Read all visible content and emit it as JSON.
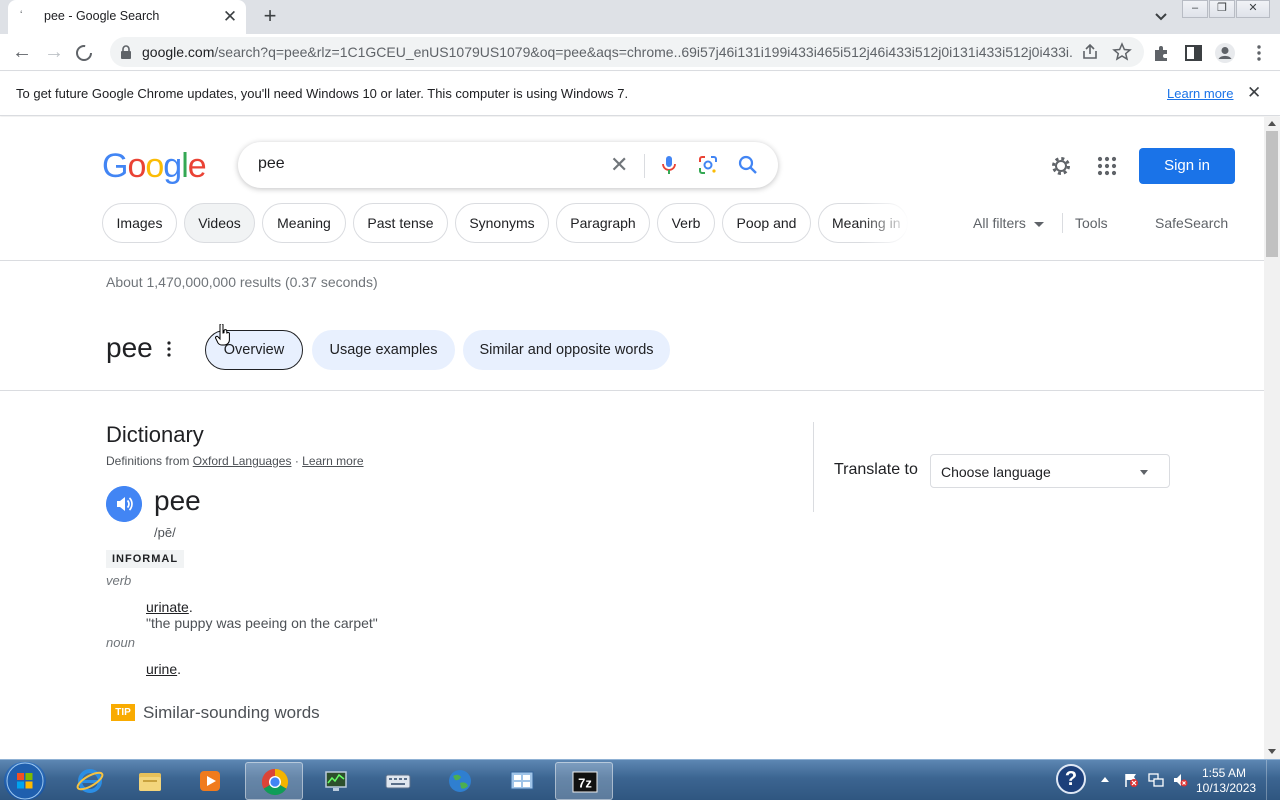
{
  "browser": {
    "tab_title": "pee - Google Search",
    "url_host": "google.com",
    "url_path": "/search?q=pee&rlz=1C1GCEU_enUS1079US1079&oq=pee&aqs=chrome..69i57j46i131i199i433i465i512j46i433i512j0i131i433i512j0i433i..."
  },
  "infobar": {
    "message": "To get future Google Chrome updates, you'll need Windows 10 or later. This computer is using Windows 7.",
    "link": "Learn more"
  },
  "search": {
    "query": "pee",
    "signin_label": "Sign in"
  },
  "chips": [
    "Images",
    "Videos",
    "Meaning",
    "Past tense",
    "Synonyms",
    "Paragraph",
    "Verb",
    "Poop and",
    "Meaning in"
  ],
  "tools": {
    "all_filters": "All filters",
    "tools": "Tools",
    "safesearch": "SafeSearch"
  },
  "stats": "About 1,470,000,000 results (0.37 seconds)",
  "term": {
    "title": "pee",
    "tabs": [
      "Overview",
      "Usage examples",
      "Similar and opposite words"
    ]
  },
  "dictionary": {
    "heading": "Dictionary",
    "source_prefix": "Definitions from",
    "source_link": "Oxford Languages",
    "separator": "·",
    "learn_more": "Learn more",
    "headword": "pee",
    "phonetic": "/pē/",
    "register": "INFORMAL",
    "pos_verb": "verb",
    "def_verb": "urinate",
    "def_verb_punct": ".",
    "example": "\"the puppy was peeing on the carpet\"",
    "pos_noun": "noun",
    "def_noun": "urine",
    "def_noun_punct": ".",
    "tip": "TIP",
    "similar_heading": "Similar-sounding words"
  },
  "translate": {
    "label": "Translate to",
    "placeholder": "Choose language"
  },
  "taskbar": {
    "time": "1:55 AM",
    "date": "10/13/2023",
    "help": "?"
  },
  "colors": {
    "google_blue": "#4285f4",
    "google_red": "#ea4335",
    "google_yellow": "#fbbc05",
    "google_green": "#34a853",
    "signin_bg": "#1a73e8",
    "pill_bg": "#e8f0fe"
  }
}
